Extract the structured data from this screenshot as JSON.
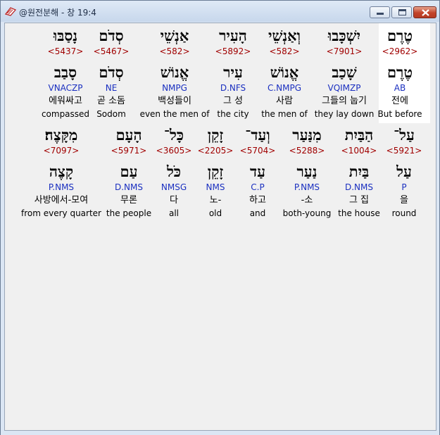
{
  "window": {
    "title": "@원전분해 - 창 19:4"
  },
  "rows": [
    {
      "tokens": [
        {
          "hebrew": "טֶרֶם",
          "strong": "<2962>",
          "lemma": "טֶרֶם",
          "morph": "AB",
          "korean": "전에",
          "english": "But before"
        },
        {
          "hebrew": "יִשְׁכָּבוּ",
          "strong": "<7901>",
          "lemma": "שָׁכַב",
          "morph": "VQIMZP",
          "korean": "그들의 눕기",
          "english": "they lay down"
        },
        {
          "hebrew": "וְאַנְשֵׁי",
          "strong": "<582>",
          "lemma": "אֱנוֹשׁ",
          "morph": "C.NMPG",
          "korean": "사람",
          "english": "the men of"
        },
        {
          "hebrew": "הָעִיר",
          "strong": "<5892>",
          "lemma": "עִיר",
          "morph": "D.NFS",
          "korean": "그 성",
          "english": "the city"
        },
        {
          "hebrew": "אַנְשֵׁי",
          "strong": "<582>",
          "lemma": "אֱנוֹשׁ",
          "morph": "NMPG",
          "korean": "백성들이",
          "english": "even the men of"
        },
        {
          "hebrew": "סְדֹם",
          "strong": "<5467>",
          "lemma": "סְדֹם",
          "morph": "NE",
          "korean": "곧 소돔",
          "english": "Sodom"
        },
        {
          "hebrew": "נָסַבּוּ",
          "strong": "<5437>",
          "lemma": "סָבַב",
          "morph": "VNACZP",
          "korean": "에워싸고",
          "english": "compassed"
        }
      ]
    },
    {
      "tokens": [
        {
          "hebrew": "עַל־",
          "strong": "<5921>",
          "lemma": "עַל",
          "morph": "P",
          "korean": "을",
          "english": "round"
        },
        {
          "hebrew": "הַבַּיִת",
          "strong": "<1004>",
          "lemma": "בַּיִת",
          "morph": "D.NMS",
          "korean": "그 집",
          "english": "the house"
        },
        {
          "hebrew": "מִנַּעַר",
          "strong": "<5288>",
          "lemma": "נַעַר",
          "morph": "P.NMS",
          "korean": "-소",
          "english": "both-young"
        },
        {
          "hebrew": "וְעַד־",
          "strong": "<5704>",
          "lemma": "עַד",
          "morph": "C.P",
          "korean": "하고",
          "english": "and"
        },
        {
          "hebrew": "זָקֵן",
          "strong": "<2205>",
          "lemma": "זָקֵן",
          "morph": "NMS",
          "korean": "노-",
          "english": "old"
        },
        {
          "hebrew": "כָּל־",
          "strong": "<3605>",
          "lemma": "כֹּל",
          "morph": "NMSG",
          "korean": "다",
          "english": "all"
        },
        {
          "hebrew": "הָעָם",
          "strong": "<5971>",
          "lemma": "עַם",
          "morph": "D.NMS",
          "korean": "무론",
          "english": "the people"
        },
        {
          "hebrew": "מִקָּצֶה׃",
          "strong": "<7097>",
          "lemma": "קָצֶה",
          "morph": "P.NMS",
          "korean": "사방에서-모여",
          "english": "from every quarter"
        }
      ]
    }
  ]
}
